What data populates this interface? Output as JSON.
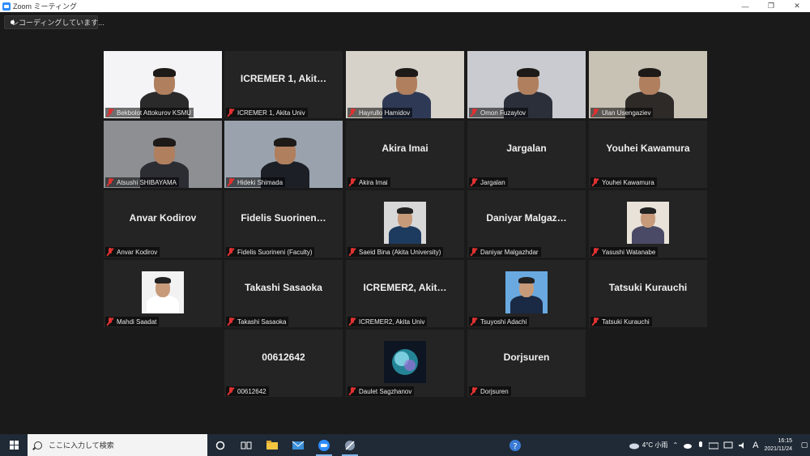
{
  "window": {
    "title": "Zoom ミーティング",
    "controls": {
      "minimize": "—",
      "restore": "❐",
      "close": "✕"
    }
  },
  "recording": {
    "label": "レコーディングしています..."
  },
  "participants": [
    {
      "name": "Bekbolot Attokurov KSMU",
      "big": "",
      "video": true
    },
    {
      "name": "ICREMER 1, Akita Univ",
      "big": "ICREMER 1, Akit…",
      "video": false
    },
    {
      "name": "Hayrullo Hamidov",
      "big": "",
      "video": true
    },
    {
      "name": "Omon Fuzaylov",
      "big": "",
      "video": true
    },
    {
      "name": "Ulan Usengaziev",
      "big": "",
      "video": true
    },
    {
      "name": "Atsushi SHIBAYAMA",
      "big": "",
      "video": true
    },
    {
      "name": "Hideki Shimada",
      "big": "",
      "video": true,
      "active": true
    },
    {
      "name": "Akira Imai",
      "big": "Akira Imai",
      "video": false
    },
    {
      "name": "Jargalan",
      "big": "Jargalan",
      "video": false
    },
    {
      "name": "Youhei Kawamura",
      "big": "Youhei Kawamura",
      "video": false
    },
    {
      "name": "Anvar Kodirov",
      "big": "Anvar Kodirov",
      "video": false
    },
    {
      "name": "Fidelis Suorineni (Faculty)",
      "big": "Fidelis Suorinen…",
      "video": false
    },
    {
      "name": "Saeid Bina (Akita University)",
      "big": "",
      "video": false,
      "thumb": true
    },
    {
      "name": "Daniyar Malgazhdar",
      "big": "Daniyar Malgaz…",
      "video": false
    },
    {
      "name": "Yasushi Watanabe",
      "big": "",
      "video": false,
      "thumb": true
    },
    {
      "name": "Mahdi Saadat",
      "big": "",
      "video": false,
      "thumb": true
    },
    {
      "name": "Takashi Sasaoka",
      "big": "Takashi Sasaoka",
      "video": false
    },
    {
      "name": "ICREMER2, Akita Univ",
      "big": "ICREMER2, Akit…",
      "video": false
    },
    {
      "name": "Tsuyoshi Adachi",
      "big": "",
      "video": false,
      "thumb": true
    },
    {
      "name": "Tatsuki Kurauchi",
      "big": "Tatsuki Kurauchi",
      "video": false
    },
    {
      "name": "00612642",
      "big": "00612642",
      "video": false
    },
    {
      "name": "Daulet Sagzhanov",
      "big": "",
      "video": false,
      "thumb": true
    },
    {
      "name": "Dorjsuren",
      "big": "Dorjsuren",
      "video": false
    }
  ],
  "taskbar": {
    "search_placeholder": "ここに入力して検索",
    "weather": "4°C 小雨",
    "ime": "A",
    "time": "16:15",
    "date": "2021/11/24"
  },
  "colors": {
    "tile_bg": "#242424",
    "active_speaker": "#a6d65c",
    "mic_muted": "#e03131",
    "taskbar": "#1f2a36"
  }
}
